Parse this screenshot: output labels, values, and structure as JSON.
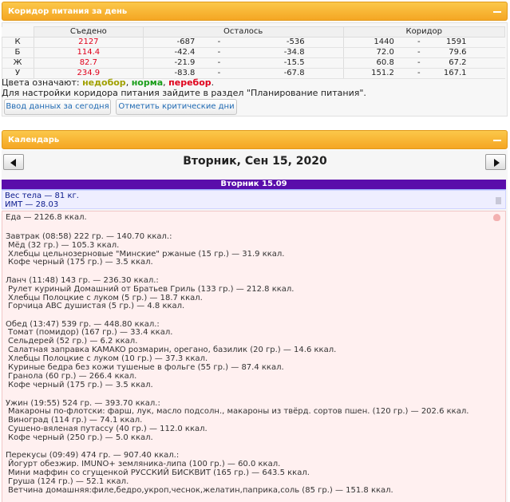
{
  "corridor_panel": {
    "title": "Коридор питания за день",
    "headers": {
      "eaten": "Съедено",
      "remaining": "Осталось",
      "corridor": "Коридор"
    },
    "rows": [
      {
        "label": "К",
        "eaten": "2127",
        "rem_min": "-687",
        "rem_max": "-536",
        "cor_min": "1440",
        "cor_max": "1591"
      },
      {
        "label": "Б",
        "eaten": "114.4",
        "rem_min": "-42.4",
        "rem_max": "-34.8",
        "cor_min": "72.0",
        "cor_max": "79.6"
      },
      {
        "label": "Ж",
        "eaten": "82.7",
        "rem_min": "-21.9",
        "rem_max": "-15.5",
        "cor_min": "60.8",
        "cor_max": "67.2"
      },
      {
        "label": "У",
        "eaten": "234.9",
        "rem_min": "-83.8",
        "rem_max": "-67.8",
        "cor_min": "151.2",
        "cor_max": "167.1"
      }
    ],
    "dash": "-",
    "legend": {
      "prefix": "Цвета означают: ",
      "under": "недобор",
      "sep1": ", ",
      "norm": "норма",
      "sep2": ", ",
      "over": "перебор",
      "suffix": "."
    },
    "hint": "Для настройки коридора питания зайдите в раздел \"Планирование питания\".",
    "buttons": {
      "enter_data": "Ввод данных за сегодня",
      "mark_critical": "Отметить критические дни"
    }
  },
  "calendar_panel": {
    "title": "Календарь",
    "date_title": "Вторник, Сен 15, 2020",
    "day_bar": "Вторник 15.09",
    "weight": "Вес тела — 81 кг.",
    "bmi": "ИМТ — 28.03"
  },
  "food": {
    "total": "Еда — 2126.8 ккал.",
    "meals": [
      {
        "title": "Завтрак (08:58) 222 гр. — 140.70 ккал.:",
        "items": [
          "Мёд (32 гр.) — 105.3 ккал.",
          "Хлебцы цельнозерновые \"Минские\" ржаные (15 гр.) — 31.9 ккал.",
          "Кофе черный (175 гр.) — 3.5 ккал."
        ]
      },
      {
        "title": "Ланч (11:48) 143 гр. — 236.30 ккал.:",
        "items": [
          "Рулет куриный Домашний от Братьев Гриль (133 гр.) — 212.8 ккал.",
          "Хлебцы Полоцкие с луком (5 гр.) — 18.7 ккал.",
          "Горчица ABC душистая (5 гр.) — 4.8 ккал."
        ]
      },
      {
        "title": "Обед (13:47) 539 гр. — 448.80 ккал.:",
        "items": [
          "Томат (помидор) (167 гр.) — 33.4 ккал.",
          "Сельдерей (52 гр.) — 6.2 ккал.",
          "Салатная заправка KAMAKO розмарин, орегано, базилик (20 гр.) — 14.6 ккал.",
          "Хлебцы Полоцкие с луком (10 гр.) — 37.3 ккал.",
          "Куриные бедра без кожи тушеные в фольге (55 гр.) — 87.4 ккал.",
          "Гранола (60 гр.) — 266.4 ккал.",
          "Кофе черный (175 гр.) — 3.5 ккал."
        ]
      },
      {
        "title": "Ужин (19:55) 524 гр. — 393.70 ккал.:",
        "items": [
          "Макароны по-флотски: фарш, лук, масло подсолн., макароны из твёрд. сортов пшен. (120 гр.) — 202.6 ккал.",
          "Виноград (114 гр.) — 74.1 ккал.",
          "Сушено-вяленая путассу (40 гр.) — 112.0 ккал.",
          "Кофе черный (250 гр.) — 5.0 ккал."
        ]
      },
      {
        "title": "Перекусы (09:49) 474 гр. — 907.40 ккал.:",
        "items": [
          "Йогурт обезжир. IMUNO+ земляника-липа (100 гр.) — 60.0 ккал.",
          "Мини маффин со сгущенкой РУССКИЙ БИСКВИТ (165 гр.) — 643.5 ккал.",
          "Груша (124 гр.) — 52.1 ккал.",
          "Ветчина домашняя:филе,бедро,укроп,чеснок,желатин,паприка,соль (85 гр.) — 151.8 ккал."
        ]
      }
    ]
  },
  "colors": {
    "accent": "#f5a623",
    "red": "#e0001b",
    "day_bar": "#5a0dab",
    "food_bg": "#fff0f0"
  }
}
